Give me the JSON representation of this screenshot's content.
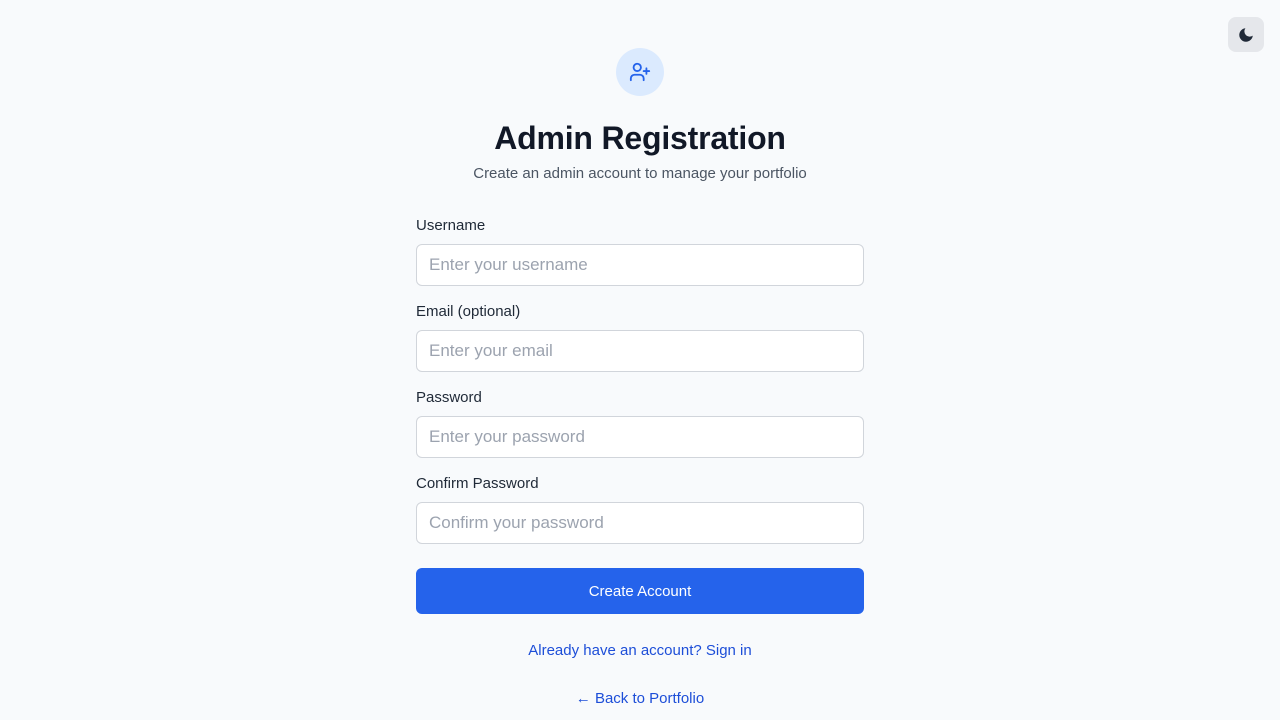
{
  "theme_toggle": {
    "icon": "moon-icon",
    "aria_label": "Toggle dark mode"
  },
  "header": {
    "icon": "user-plus-icon",
    "title": "Admin Registration",
    "subtitle": "Create an admin account to manage your portfolio"
  },
  "form": {
    "fields": [
      {
        "label": "Username",
        "placeholder": "Enter your username",
        "value": ""
      },
      {
        "label": "Email (optional)",
        "placeholder": "Enter your email",
        "value": ""
      },
      {
        "label": "Password",
        "placeholder": "Enter your password",
        "value": ""
      },
      {
        "label": "Confirm Password",
        "placeholder": "Confirm your password",
        "value": ""
      }
    ],
    "submit_label": "Create Account"
  },
  "links": {
    "sign_in": "Already have an account? Sign in",
    "back": "← Back to Portfolio"
  },
  "colors": {
    "background": "#f8fafc",
    "primary": "#2563eb",
    "link": "#1d4ed8",
    "icon_bg": "#dbeafe",
    "toggle_bg": "#e5e7eb"
  }
}
